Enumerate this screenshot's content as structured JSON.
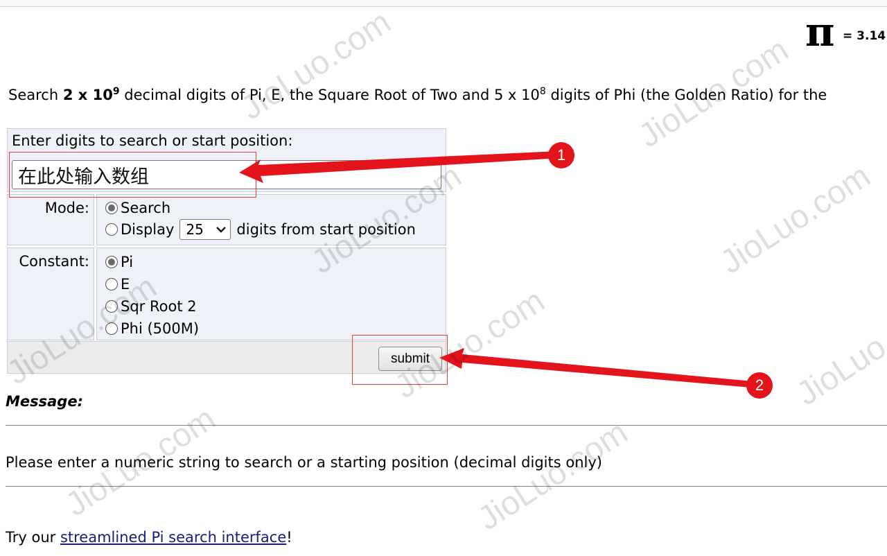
{
  "header": {
    "pi_symbol": "π",
    "pi_value": "= 3.14"
  },
  "intro": {
    "prefix": "Search ",
    "count_bold": "2 x 10",
    "count_exp": "9",
    "middle": " decimal digits of Pi, E, the Square Root of Two and 5 x 10",
    "phi_exp": "8",
    "suffix": " digits of Phi (the Golden Ratio) for the"
  },
  "form": {
    "digits_label": "Enter digits to search or start position:",
    "digits_value": "在此处输入数组",
    "mode_label": "Mode:",
    "mode_options": {
      "search": "Search",
      "display": "Display",
      "display_suffix": "digits from start position"
    },
    "display_count": "25",
    "constant_label": "Constant:",
    "constants": [
      "Pi",
      "E",
      "Sqr Root 2",
      "Phi (500M)"
    ],
    "submit_label": "submit"
  },
  "message": {
    "title": "Message:",
    "text": "Please enter a numeric string to search or a starting position (decimal digits only)"
  },
  "footer": {
    "prefix": "Try our ",
    "link_text": "streamlined Pi search interface",
    "suffix": "!"
  },
  "annotations": {
    "badge_1": "1",
    "badge_2": "2",
    "color": "#e3141b"
  },
  "watermark": "JioLuo.com"
}
